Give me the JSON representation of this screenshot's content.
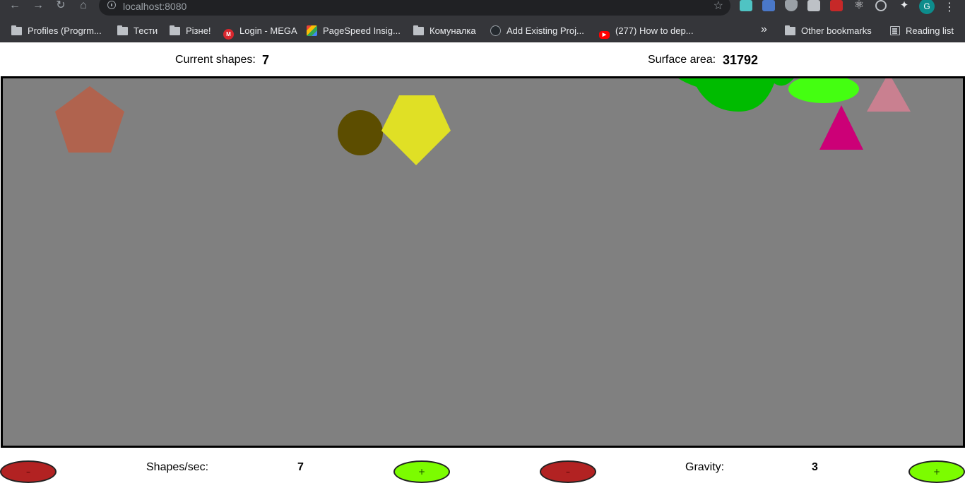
{
  "browser": {
    "url": "localhost:8080",
    "bookmarks": [
      {
        "label": "Profiles (Progrm...",
        "icon": "folder-icon"
      },
      {
        "label": "Тести",
        "icon": "folder-icon"
      },
      {
        "label": "Різне!",
        "icon": "folder-icon"
      },
      {
        "label": "Login - MEGA",
        "icon": "mega-icon"
      },
      {
        "label": "PageSpeed Insig...",
        "icon": "pagespeed-icon"
      },
      {
        "label": "Комуналка",
        "icon": "folder-icon"
      },
      {
        "label": "Add Existing Proj...",
        "icon": "github-icon"
      },
      {
        "label": "(277) How to dep...",
        "icon": "youtube-icon"
      }
    ],
    "other_bookmarks": "Other bookmarks",
    "reading_list": "Reading list",
    "profile_initial": "G"
  },
  "stats": {
    "current_shapes_label": "Current shapes:",
    "current_shapes_value": "7",
    "surface_area_label": "Surface area:",
    "surface_area_value": "31792"
  },
  "shapes": [
    {
      "type": "pentagon",
      "color": "#b0634e"
    },
    {
      "type": "circle",
      "color": "#5c4d00"
    },
    {
      "type": "pentagon",
      "color": "#e0e025"
    },
    {
      "type": "blob",
      "color": "#00bb00"
    },
    {
      "type": "ellipse",
      "color": "#44ff11"
    },
    {
      "type": "triangle",
      "color": "#c98090"
    },
    {
      "type": "triangle",
      "color": "#cc0077"
    }
  ],
  "controls": {
    "shapes_per_sec_label": "Shapes/sec:",
    "shapes_per_sec_value": "7",
    "gravity_label": "Gravity:",
    "gravity_value": "3",
    "minus_label": "–",
    "plus_label": "+"
  },
  "colors": {
    "canvas_bg": "#808080",
    "minus_button": "#b22222",
    "plus_button": "#7cfc00"
  }
}
